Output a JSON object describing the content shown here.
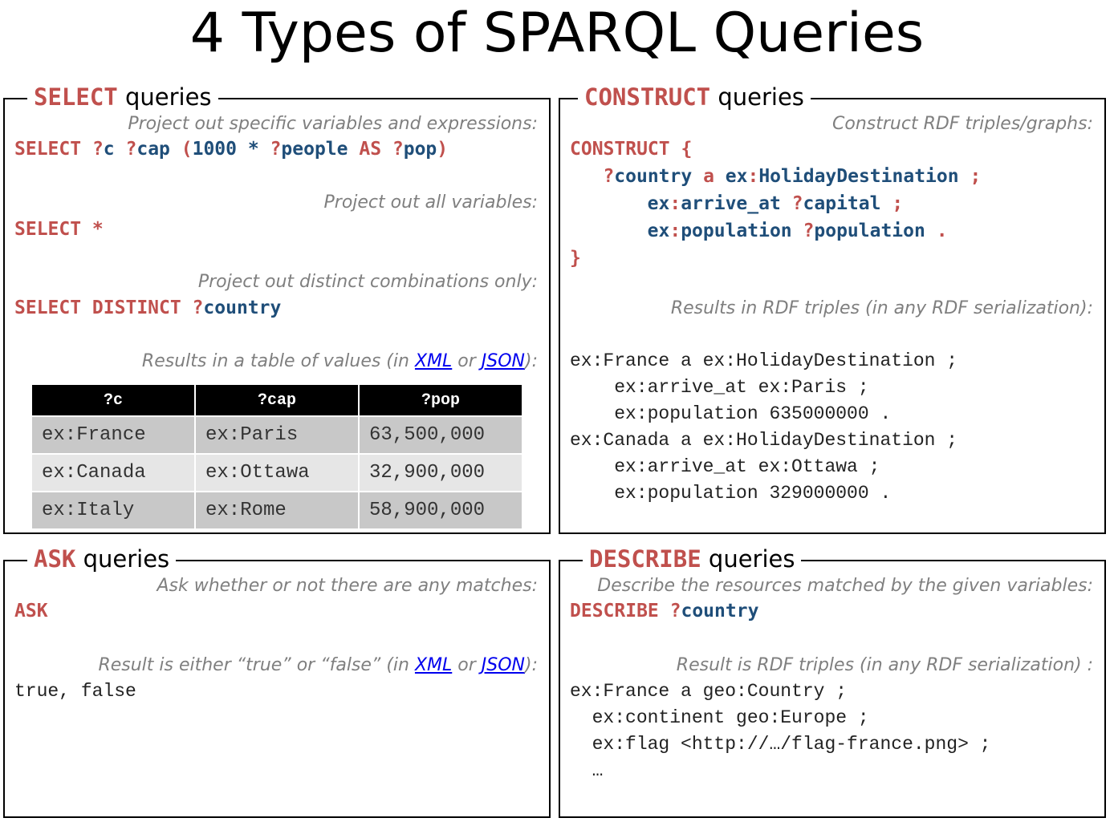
{
  "title": "4 Types of SPARQL Queries",
  "select": {
    "kw": "SELECT",
    "heading": " queries",
    "note1": "Project out specific variables and expressions:",
    "note2": "Project out all variables:",
    "note3": "Project out distinct combinations only:",
    "note4_pre": "Results in a table of values (in ",
    "xml": "XML",
    "or": " or ",
    "json": "JSON",
    "note4_post": "):",
    "table": {
      "headers": [
        "?c",
        "?cap",
        "?pop"
      ],
      "rows": [
        [
          "ex:France",
          "ex:Paris",
          "63,500,000"
        ],
        [
          "ex:Canada",
          "ex:Ottawa",
          "32,900,000"
        ],
        [
          "ex:Italy",
          "ex:Rome",
          "58,900,000"
        ]
      ]
    }
  },
  "construct": {
    "kw": "CONSTRUCT",
    "heading": " queries",
    "note1": "Construct RDF triples/graphs:",
    "note2": "Results in RDF triples (in any RDF serialization):",
    "output": [
      "ex:France a ex:HolidayDestination ;",
      "    ex:arrive_at ex:Paris ;",
      "    ex:population 635000000 .",
      "ex:Canada a ex:HolidayDestination ;",
      "    ex:arrive_at ex:Ottawa ;",
      "    ex:population 329000000 ."
    ]
  },
  "ask": {
    "kw": "ASK",
    "heading": " queries",
    "note1": "Ask whether or not there are any matches:",
    "note2_pre": "Result is either “true” or “false” (in ",
    "xml": "XML",
    "or": " or ",
    "json": "JSON",
    "note2_post": "):",
    "output": "true, false"
  },
  "describe": {
    "kw": "DESCRIBE",
    "heading": " queries",
    "note1": "Describe the resources matched by the given variables:",
    "note2": "Result is RDF triples (in any RDF serialization) :",
    "output": [
      "ex:France a geo:Country ;",
      "  ex:continent geo:Europe ;",
      "  ex:flag <http://…/flag-france.png> ;",
      "  …"
    ]
  },
  "colors": {
    "keyword": "#c0504d",
    "variable": "#1f4e79",
    "note": "#7f7f7f"
  }
}
